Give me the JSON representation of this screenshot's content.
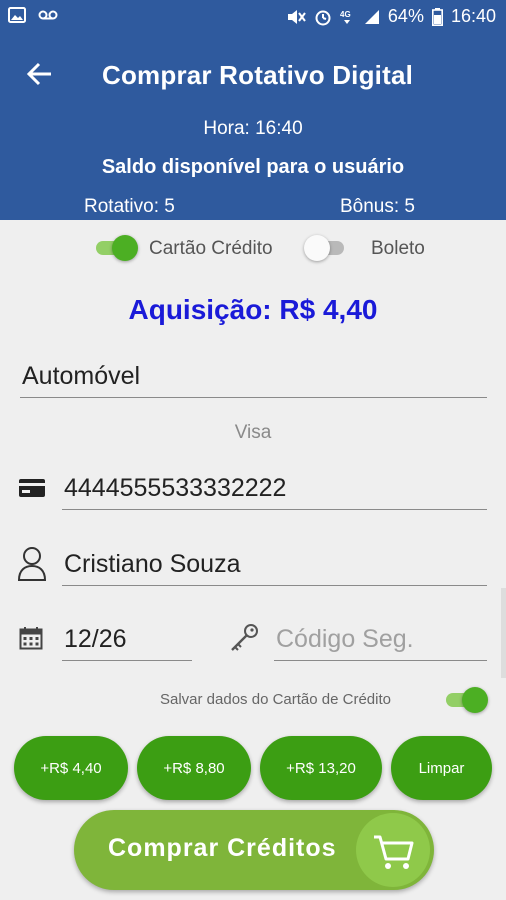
{
  "status_bar": {
    "left_icons": [
      "image-icon",
      "voicemail-icon"
    ],
    "right_icons": [
      "mute-icon",
      "alarm-icon",
      "4g-icon",
      "signal-icon"
    ],
    "battery": "64%",
    "battery_icon": "battery-icon",
    "time": "16:40"
  },
  "header": {
    "back_icon": "arrow-back-icon",
    "title": "Comprar Rotativo Digital",
    "hora": "Hora: 16:40",
    "saldo": "Saldo disponível para o usuário",
    "rotativo": "Rotativo: 5",
    "bonus": "Bônus: 5",
    "bg_color": "#2f5a9e"
  },
  "payment": {
    "cartao_label": "Cartão Crédito",
    "cartao_on": true,
    "boleto_label": "Boleto",
    "boleto_on": false
  },
  "aquisicao": "Aquisição: R$ 4,40",
  "form": {
    "vehicle": "Automóvel",
    "brand": "Visa",
    "card_number": "4444555533332222",
    "name": "Cristiano Souza",
    "expiry": "12/26",
    "cvv_placeholder": "Código Seg.",
    "save_label": "Salvar dados do Cartão de Crédito",
    "save_on": true
  },
  "amount_buttons": [
    "+R$ 4,40",
    "+R$ 8,80",
    "+R$ 13,20",
    "Limpar"
  ],
  "buy_button": {
    "label": "Comprar Créditos",
    "icon": "cart-icon"
  },
  "colors": {
    "accent_green": "#3c9e13",
    "buy_green": "#7fb53a",
    "aquisicao_blue": "#1a1ad8"
  }
}
